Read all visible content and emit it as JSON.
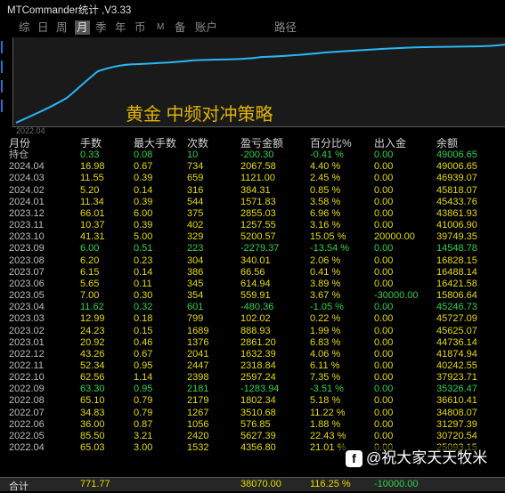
{
  "window": {
    "title": "MTCommander统计 ,V3.33"
  },
  "menu": [
    "综",
    "日",
    "周",
    "月",
    "季",
    "年",
    "币",
    "M",
    "备",
    "账户",
    "路径"
  ],
  "menu_active": 3,
  "chart": {
    "title": "黄金 中频对冲策略",
    "x_start_label": "2022.04",
    "line_color": "#29b6f6"
  },
  "table": {
    "headers": [
      "月份",
      "手数",
      "最大手数",
      "次数",
      "盈亏金额",
      "百分比%",
      "出入金",
      "余额"
    ],
    "rows": [
      [
        "持仓",
        "0.33",
        "0.08",
        "10",
        "-200.30",
        "-0.41 %",
        "0.00",
        "49006.65"
      ],
      [
        "2024.04",
        "16.98",
        "0.67",
        "734",
        "2067.58",
        "4.40 %",
        "0.00",
        "49006.65"
      ],
      [
        "2024.03",
        "11.55",
        "0.39",
        "659",
        "1121.00",
        "2.45 %",
        "0.00",
        "46939.07"
      ],
      [
        "2024.02",
        "5.20",
        "0.14",
        "316",
        "384.31",
        "0.85 %",
        "0.00",
        "45818.07"
      ],
      [
        "2024.01",
        "11.34",
        "0.39",
        "544",
        "1571.83",
        "3.58 %",
        "0.00",
        "45433.76"
      ],
      [
        "2023.12",
        "66.01",
        "6.00",
        "375",
        "2855.03",
        "6.96 %",
        "0.00",
        "43861.93"
      ],
      [
        "2023.11",
        "10.37",
        "0.39",
        "402",
        "1257.55",
        "3.16 %",
        "0.00",
        "41006.90"
      ],
      [
        "2023.10",
        "41.31",
        "5.00",
        "329",
        "5200.57",
        "15.05 %",
        "20000.00",
        "39749.35"
      ],
      [
        "2023.09",
        "6.00",
        "0.51",
        "223",
        "-2279.37",
        "-13.54 %",
        "0.00",
        "14548.78"
      ],
      [
        "2023.08",
        "6.20",
        "0.23",
        "304",
        "340.01",
        "2.06 %",
        "0.00",
        "16828.15"
      ],
      [
        "2023.07",
        "6.15",
        "0.14",
        "386",
        "66.56",
        "0.41 %",
        "0.00",
        "16488.14"
      ],
      [
        "2023.06",
        "5.65",
        "0.11",
        "345",
        "614.94",
        "3.89 %",
        "0.00",
        "16421.58"
      ],
      [
        "2023.05",
        "7.00",
        "0.30",
        "354",
        "559.91",
        "3.67 %",
        "-30000.00",
        "15806.64"
      ],
      [
        "2023.04",
        "11.62",
        "0.32",
        "601",
        "-480.36",
        "-1.05 %",
        "0.00",
        "45246.73"
      ],
      [
        "2023.03",
        "12.99",
        "0.18",
        "799",
        "102.02",
        "0.22 %",
        "0.00",
        "45727.09"
      ],
      [
        "2023.02",
        "24.23",
        "0.15",
        "1689",
        "888.93",
        "1.99 %",
        "0.00",
        "45625.07"
      ],
      [
        "2023.01",
        "20.92",
        "0.46",
        "1376",
        "2861.20",
        "6.83 %",
        "0.00",
        "44736.14"
      ],
      [
        "2022.12",
        "43.26",
        "0.67",
        "2041",
        "1632.39",
        "4.06 %",
        "0.00",
        "41874.94"
      ],
      [
        "2022.11",
        "52.34",
        "0.95",
        "2447",
        "2318.84",
        "6.11 %",
        "0.00",
        "40242.55"
      ],
      [
        "2022.10",
        "62.56",
        "1.14",
        "2398",
        "2597.24",
        "7.35 %",
        "0.00",
        "37923.71"
      ],
      [
        "2022.09",
        "63.30",
        "0.95",
        "2181",
        "-1283.94",
        "-3.51 %",
        "0.00",
        "35326.47"
      ],
      [
        "2022.08",
        "65.10",
        "0.79",
        "2179",
        "1802.34",
        "5.18 %",
        "0.00",
        "36610.41"
      ],
      [
        "2022.07",
        "34.83",
        "0.79",
        "1267",
        "3510.68",
        "11.22 %",
        "0.00",
        "34808.07"
      ],
      [
        "2022.06",
        "36.00",
        "0.87",
        "1056",
        "576.85",
        "1.88 %",
        "0.00",
        "31297.39"
      ],
      [
        "2022.05",
        "85.50",
        "3.21",
        "2420",
        "5627.39",
        "22.43 %",
        "0.00",
        "30720.54"
      ],
      [
        "2022.04",
        "65.03",
        "3.00",
        "1532",
        "4356.80",
        "21.01 %",
        "0.00",
        "25093.15"
      ]
    ],
    "row_colors": [
      "g",
      "y",
      "y",
      "y",
      "y",
      "y",
      "y",
      "y",
      "g",
      "y",
      "y",
      "y",
      "y",
      "g",
      "y",
      "y",
      "y",
      "y",
      "y",
      "y",
      "g",
      "y",
      "y",
      "y",
      "y",
      "y"
    ],
    "summary": [
      "合计",
      "771.77",
      "",
      "",
      "38070.00",
      "116.25 %",
      "-10000.00",
      ""
    ]
  },
  "watermark": {
    "icon": "facebook-icon",
    "icon_glyph": "f",
    "text": "@祝大家天天牧米"
  }
}
